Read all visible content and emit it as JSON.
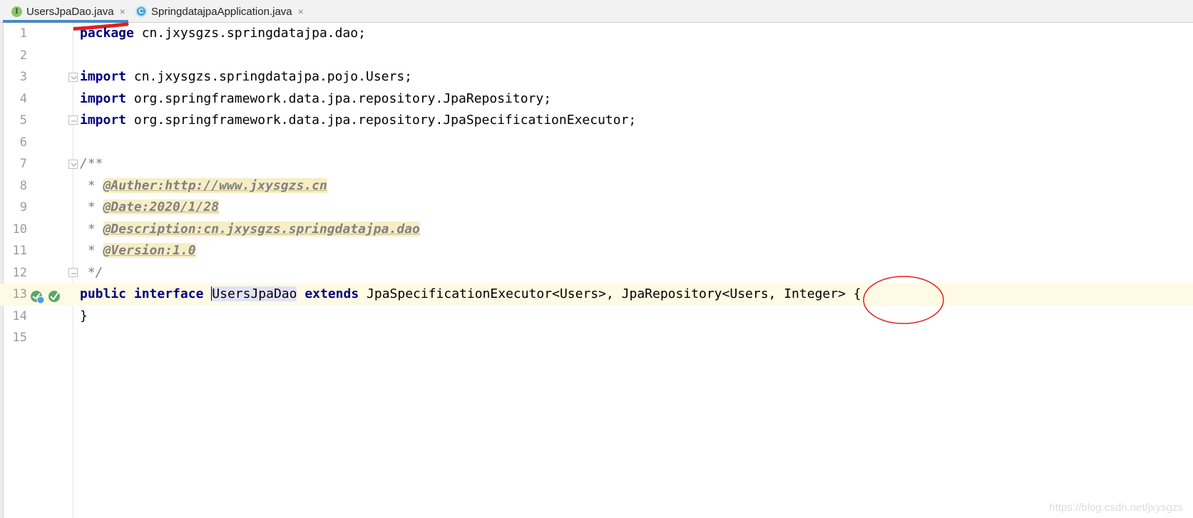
{
  "tabs": [
    {
      "label": "UsersJpaDao.java",
      "icon": "interface-icon",
      "active": true
    },
    {
      "label": "SpringdatajpaApplication.java",
      "icon": "class-icon",
      "active": false
    }
  ],
  "tab_close_glyph": "×",
  "icon_letters": {
    "interface": "I",
    "class": "C"
  },
  "editor": {
    "line_numbers": [
      "1",
      "2",
      "3",
      "4",
      "5",
      "6",
      "7",
      "8",
      "9",
      "10",
      "11",
      "12",
      "13",
      "14",
      "15"
    ],
    "current_line": 13,
    "lines": {
      "l1": {
        "kw": "package",
        "rest": " cn.jxysgzs.springdatajpa.dao;"
      },
      "l3": {
        "kw": "import",
        "rest": " cn.jxysgzs.springdatajpa.pojo.Users;"
      },
      "l4": {
        "kw": "import",
        "rest": " org.springframework.data.jpa.repository.JpaRepository;"
      },
      "l5": {
        "kw": "import",
        "rest": " org.springframework.data.jpa.repository.JpaSpecificationExecutor;"
      },
      "l7": {
        "comment": "/**"
      },
      "l8": {
        "prefix": " * ",
        "tag": "@Auther:http://www.jxysgzs.cn"
      },
      "l9": {
        "prefix": " * ",
        "tag": "@Date:2020/1/28"
      },
      "l10": {
        "prefix": " * ",
        "tag": "@Description:cn.jxysgzs.springdatajpa.dao"
      },
      "l11": {
        "prefix": " * ",
        "tag": "@Version:1.0"
      },
      "l12": {
        "comment": " */"
      },
      "l13": {
        "kw1": "public",
        "kw2": "interface",
        "name": "UsersJpaDao",
        "kw3": "extends",
        "rest": " JpaSpecificationExecutor<Users>, JpaRepository<Users, Integer> {"
      },
      "l14": {
        "text": "}"
      }
    }
  },
  "watermark": "https://blog.csdn.net/jxysgzs",
  "colors": {
    "keyword": "#000080",
    "comment": "#808080",
    "tag_highlight": "#f7eec6",
    "current_line": "#fffae3",
    "selection": "#e2e2f7",
    "annotation_red": "#e0201e",
    "active_tab_underline": "#4a88c7"
  }
}
